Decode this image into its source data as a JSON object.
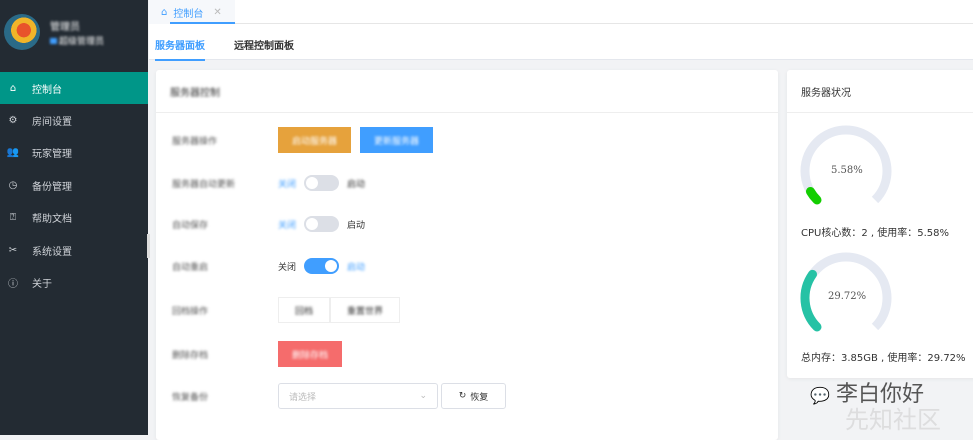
{
  "sidebar": {
    "username": "管理员",
    "role": "超级管理员",
    "items": [
      {
        "label": "控制台",
        "icon": "home-icon"
      },
      {
        "label": "房间设置",
        "icon": "gear-icon"
      },
      {
        "label": "玩家管理",
        "icon": "users-icon"
      },
      {
        "label": "备份管理",
        "icon": "clock-icon"
      },
      {
        "label": "帮助文档",
        "icon": "help-doc-icon"
      },
      {
        "label": "系统设置",
        "icon": "tools-icon"
      },
      {
        "label": "关于",
        "icon": "info-icon"
      }
    ]
  },
  "tabs": [
    {
      "label": "控制台"
    }
  ],
  "subtabs": [
    "服务器面板",
    "远程控制面板"
  ],
  "panel": {
    "title": "服务器控制",
    "rows": [
      {
        "label": "服务器操作",
        "buttons": [
          "启动服务器",
          "更新服务器"
        ]
      },
      {
        "label": "服务器自动更新",
        "off": "关闭",
        "on": "启动"
      },
      {
        "label": "自动保存",
        "off": "关闭",
        "on": "启动"
      },
      {
        "label": "自动重启",
        "off": "关闭",
        "on": "启动"
      },
      {
        "label": "回档操作",
        "buttons": [
          "回档",
          "重置世界"
        ]
      },
      {
        "label": "删除存档",
        "button": "删除存档"
      },
      {
        "label": "恢复备份",
        "placeholder": "请选择",
        "restore": "恢复"
      }
    ]
  },
  "status": {
    "title": "服务器状况",
    "cpu": {
      "percent": 5.58,
      "label": "5.58%",
      "info": "CPU核心数：2 , 使用率：5.58%",
      "color": "#13ce00"
    },
    "mem": {
      "percent": 29.72,
      "label": "29.72%",
      "info": "总内存：3.85GB , 使用率：29.72%",
      "color": "#26c2a5"
    }
  },
  "watermark": {
    "line1": "李白你好",
    "line2": "先知社区"
  }
}
